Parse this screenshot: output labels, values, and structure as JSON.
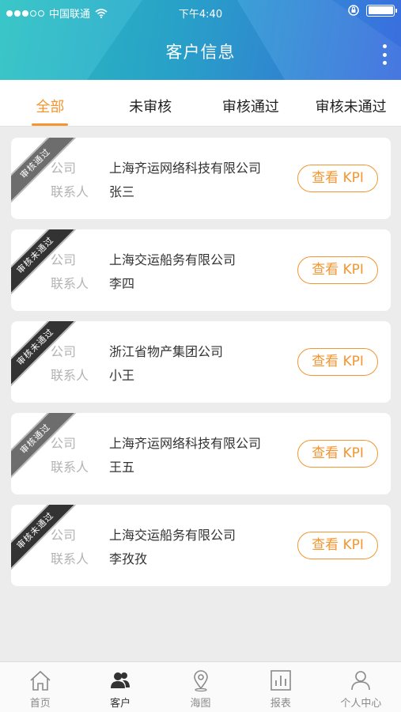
{
  "status": {
    "carrier": "中国联通",
    "time": "下午4:40"
  },
  "header": {
    "title": "客户信息"
  },
  "tabs": [
    {
      "label": "全部",
      "active": true
    },
    {
      "label": "未审核",
      "active": false
    },
    {
      "label": "审核通过",
      "active": false
    },
    {
      "label": "审核未通过",
      "active": false
    }
  ],
  "labels": {
    "company": "公司",
    "contact": "联系人",
    "kpi_button": "查看 KPI"
  },
  "customers": [
    {
      "badge": "审核通过",
      "company": "上海齐运网络科技有限公司",
      "contact": "张三"
    },
    {
      "badge": "审核未通过",
      "company": "上海交运船务有限公司",
      "contact": "李四"
    },
    {
      "badge": "审核未通过",
      "company": "浙江省物产集团公司",
      "contact": "小王"
    },
    {
      "badge": "审核通过",
      "company": "上海齐运网络科技有限公司",
      "contact": "王五"
    },
    {
      "badge": "审核未通过",
      "company": "上海交运船务有限公司",
      "contact": "李孜孜"
    }
  ],
  "bottom_nav": [
    {
      "label": "首页",
      "icon": "home-icon"
    },
    {
      "label": "客户",
      "icon": "users-icon",
      "active": true
    },
    {
      "label": "海图",
      "icon": "map-pin-icon"
    },
    {
      "label": "报表",
      "icon": "bar-chart-icon"
    },
    {
      "label": "个人中心",
      "icon": "user-icon"
    }
  ],
  "colors": {
    "accent": "#f39631",
    "header_start": "#2ec4c4",
    "header_end": "#3a6ddf"
  }
}
